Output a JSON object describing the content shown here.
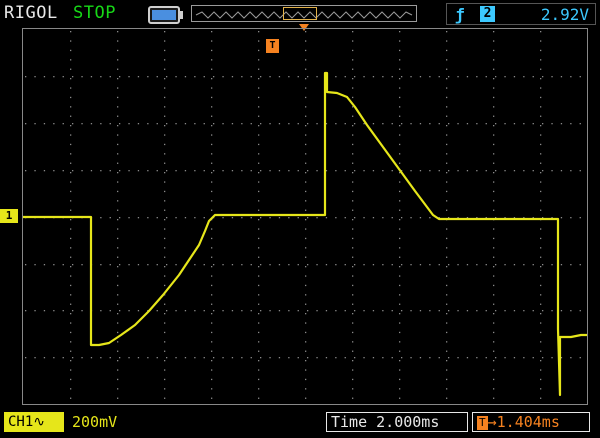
{
  "header": {
    "brand": "RIGOL",
    "run_state": "STOP",
    "battery_icon": "battery-icon",
    "trigger_edge_icon": "rising-edge-icon",
    "trigger_source_chip": "2",
    "trigger_level": "2.92V"
  },
  "display": {
    "ch1_marker": "1",
    "trigger_position_marker": "T",
    "waveform_color": "#e6e61a",
    "grid_color": "#8a8a8a",
    "trigger_color": "#f58220"
  },
  "footer": {
    "channel_label": "CH1",
    "channel_coupling_icon": "ac-coupling-icon",
    "channel_scale": "200mV",
    "timebase": "Time 2.000ms",
    "delay_chip": "T",
    "delay_value": "1.404ms"
  }
}
